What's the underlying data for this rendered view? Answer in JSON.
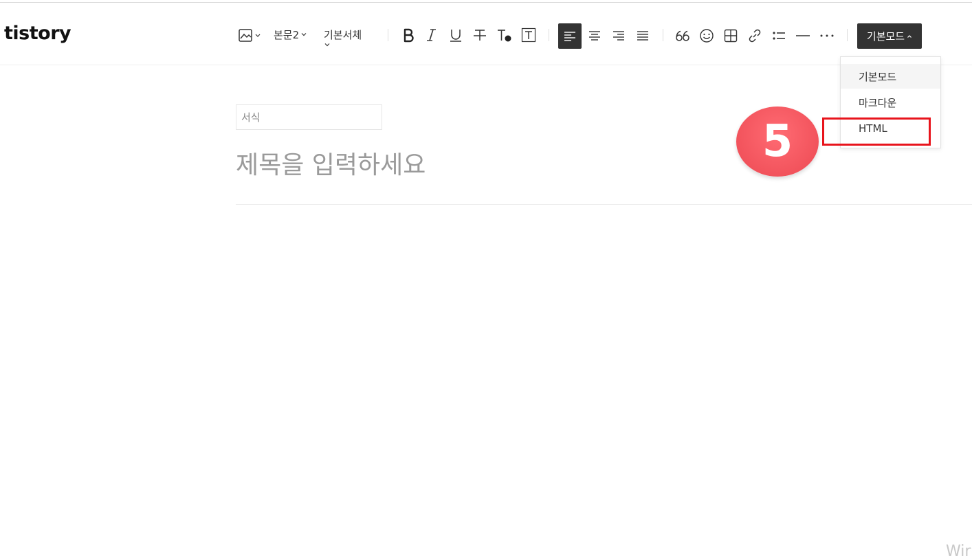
{
  "app": {
    "logo": "tistory"
  },
  "toolbar": {
    "paragraph_style": "본문2",
    "font_family": "기본서체",
    "mode_button": "기본모드"
  },
  "mode_menu": {
    "items": [
      "기본모드",
      "마크다운",
      "HTML"
    ],
    "selected": "기본모드"
  },
  "annotation": {
    "step_number": "5",
    "highlight_color": "#e8141c",
    "badge_color": "#f2535c"
  },
  "editor": {
    "category_placeholder": "서식",
    "title_placeholder": "제목을 입력하세요"
  },
  "watermark": "Wir"
}
